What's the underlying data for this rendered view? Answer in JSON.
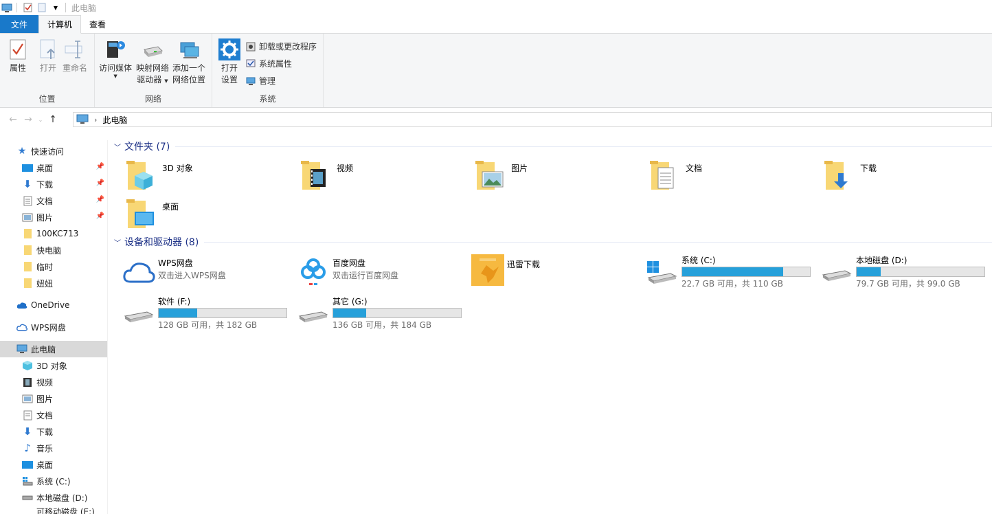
{
  "titlebar": {
    "title": "此电脑"
  },
  "tabs": {
    "file": "文件",
    "computer": "计算机",
    "view": "查看"
  },
  "ribbon": {
    "location": {
      "label": "位置",
      "properties": "属性",
      "open": "打开",
      "rename": "重命名"
    },
    "network": {
      "label": "网络",
      "access_media": "访问媒体",
      "map_drive_1": "映射网络",
      "map_drive_2": "驱动器",
      "add_location_1": "添加一个",
      "add_location_2": "网络位置"
    },
    "system": {
      "label": "系统",
      "open_settings_1": "打开",
      "open_settings_2": "设置",
      "uninstall": "卸载或更改程序",
      "sys_props": "系统属性",
      "manage": "管理"
    }
  },
  "address": {
    "path": "此电脑"
  },
  "nav": {
    "quick_access": "快速访问",
    "qa_items": [
      "桌面",
      "下载",
      "文档",
      "图片",
      "100KC713",
      "快电脑",
      "临时",
      "妞妞"
    ],
    "onedrive": "OneDrive",
    "wps": "WPS网盘",
    "this_pc": "此电脑",
    "pc_items": [
      "3D 对象",
      "视频",
      "图片",
      "文档",
      "下载",
      "音乐",
      "桌面",
      "系统 (C:)",
      "本地磁盘 (D:)",
      "可移动磁盘 (E:)"
    ]
  },
  "content": {
    "folders_header": "文件夹 (7)",
    "folders": [
      "3D 对象",
      "视频",
      "图片",
      "文档",
      "下载",
      "桌面"
    ],
    "devices_header": "设备和驱动器 (8)",
    "wps": {
      "name": "WPS网盘",
      "sub": "双击进入WPS网盘"
    },
    "baidu": {
      "name": "百度网盘",
      "sub": "双击运行百度网盘"
    },
    "xunlei": {
      "name": "迅雷下载"
    },
    "drives": [
      {
        "name": "系统 (C:)",
        "sub": "22.7 GB 可用，共 110 GB",
        "used": 0.79
      },
      {
        "name": "本地磁盘 (D:)",
        "sub": "79.7 GB 可用，共 99.0 GB",
        "used": 0.19
      },
      {
        "name": "软件 (F:)",
        "sub": "128 GB 可用，共 182 GB",
        "used": 0.3
      },
      {
        "name": "其它 (G:)",
        "sub": "136 GB 可用，共 184 GB",
        "used": 0.26
      }
    ]
  },
  "colors": {
    "accent": "#1979ca",
    "header_text": "#1e3287",
    "bar_fill": "#26a0da",
    "folder": "#f8d775"
  }
}
